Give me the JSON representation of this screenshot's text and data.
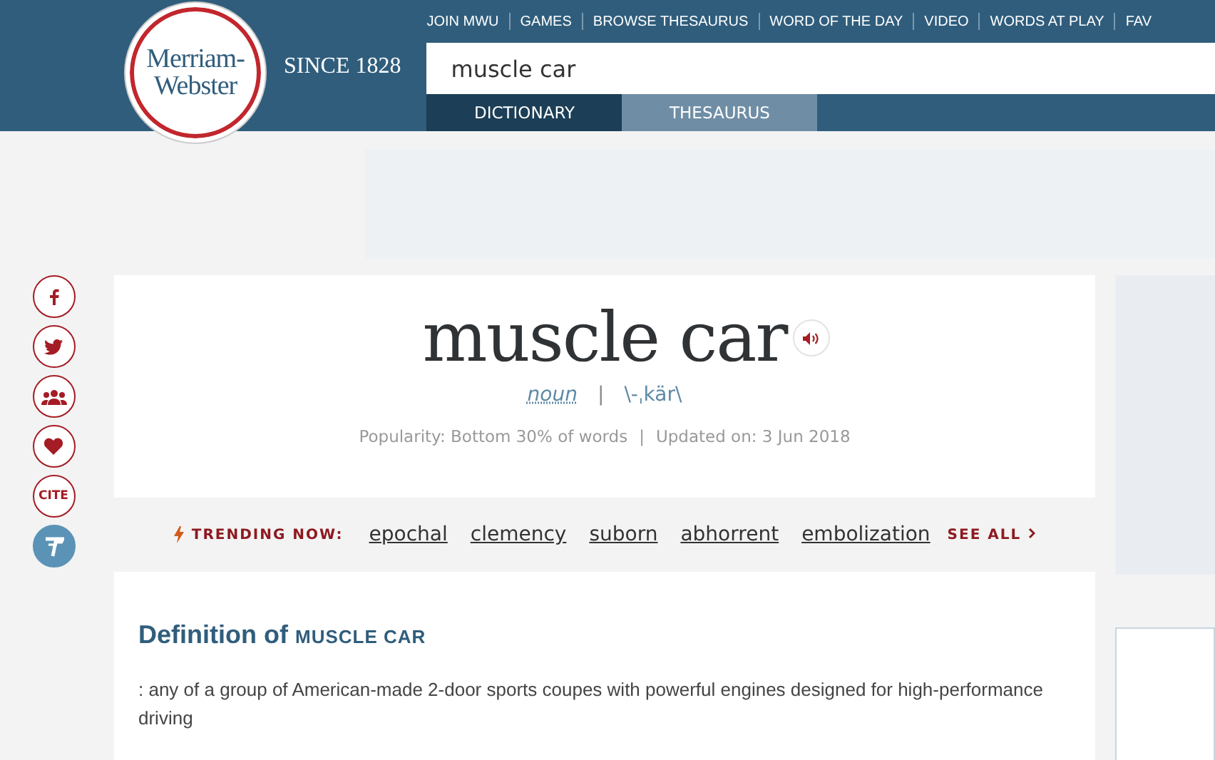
{
  "header": {
    "logo_line_1": "Merriam-",
    "logo_line_2": "Webster",
    "since": "SINCE 1828",
    "nav": [
      "JOIN MWU",
      "GAMES",
      "BROWSE THESAURUS",
      "WORD OF THE DAY",
      "VIDEO",
      "WORDS AT PLAY",
      "FAV"
    ],
    "search": {
      "value": "muscle car"
    },
    "tabs": [
      {
        "label": "DICTIONARY",
        "selected": true
      },
      {
        "label": "THESAURUS",
        "selected": false
      }
    ]
  },
  "social": {
    "cite": "CITE"
  },
  "entry": {
    "headword": "muscle car",
    "part_of_speech": "noun",
    "separator": "|",
    "pronunciation": "\\-ˌkär\\",
    "popularity": "Popularity: Bottom 30% of words",
    "meta_separator": "|",
    "updated": "Updated on: 3 Jun 2018"
  },
  "trending": {
    "label": "TRENDING NOW:",
    "words": [
      "epochal",
      "clemency",
      "suborn",
      "abhorrent",
      "embolization"
    ],
    "see_all": "SEE ALL"
  },
  "definition": {
    "heading": "Definition of",
    "headword": "MUSCLE CAR",
    "text": ": any of a group of American-made 2-door sports coupes with powerful engines designed for high-performance driving"
  }
}
